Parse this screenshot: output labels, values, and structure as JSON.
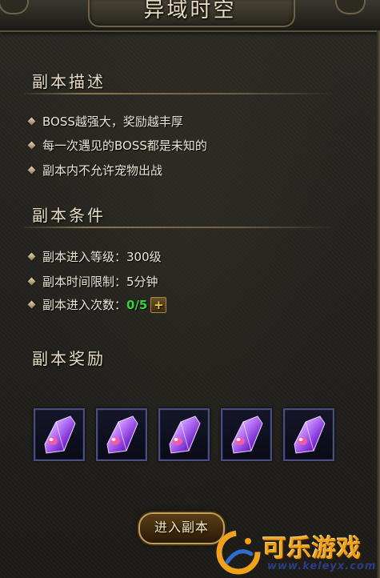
{
  "window": {
    "title": "异域时空"
  },
  "description": {
    "heading": "副本描述",
    "items": [
      "BOSS越强大，奖励越丰厚",
      "每一次遇见的BOSS都是未知的",
      "副本内不允许宠物出战"
    ]
  },
  "conditions": {
    "heading": "副本条件",
    "level_label": "副本进入等级：",
    "level_value": "300级",
    "time_label": "副本时间限制：",
    "time_value": "5分钟",
    "entries_label": "副本进入次数：",
    "entries_value": "0/5",
    "add_button": "+"
  },
  "rewards": {
    "heading": "副本奖励",
    "items": [
      {
        "icon": "purple-crystal-icon"
      },
      {
        "icon": "purple-crystal-icon"
      },
      {
        "icon": "purple-crystal-icon"
      },
      {
        "icon": "purple-crystal-icon"
      },
      {
        "icon": "purple-crystal-icon"
      }
    ]
  },
  "enter_button": "进入副本",
  "watermark": {
    "name": "可乐游戏",
    "url": "www.keleyx.com"
  },
  "colors": {
    "accent_green": "#35d43a",
    "gold_border": "#c2a05a",
    "slot_border": "#4b4e80",
    "watermark_orange": "#f0a21c",
    "watermark_blue": "#2c3f86"
  }
}
